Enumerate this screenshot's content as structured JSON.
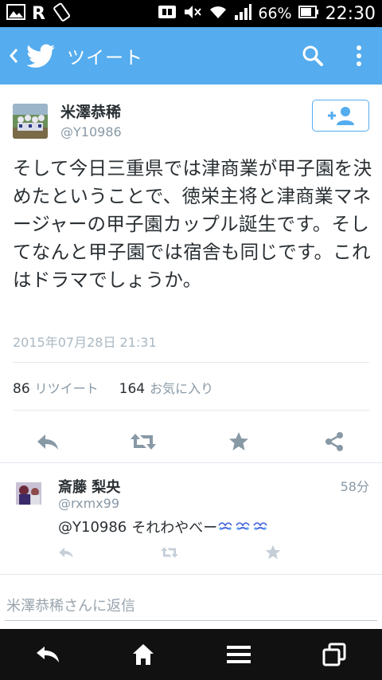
{
  "status_bar": {
    "r_label": "R",
    "battery": "66%",
    "time": "22:30"
  },
  "app_bar": {
    "title": "ツイート"
  },
  "tweet": {
    "author_name": "米澤恭稀",
    "author_handle": "@Y10986",
    "text": "そして今日三重県では津商業が甲子園を決めたということで、徳栄主将と津商業マネージャーの甲子園カップル誕生です。そしてなんと甲子園では宿舎も同じです。これはドラマでしょうか。",
    "date": "2015年07月28日 21:31",
    "retweet_count": "86",
    "retweet_label": "リツイート",
    "favorite_count": "164",
    "favorite_label": "お気に入り"
  },
  "reply": {
    "author_name": "斎藤 梨央",
    "author_handle": "@rxmx99",
    "time": "58分",
    "mention": "@Y10986",
    "text": "それわやべー"
  },
  "reply_box": {
    "placeholder": "米澤恭稀さんに返信"
  },
  "colors": {
    "accent": "#55acee",
    "muted": "#8899a6",
    "text": "#292f33"
  }
}
